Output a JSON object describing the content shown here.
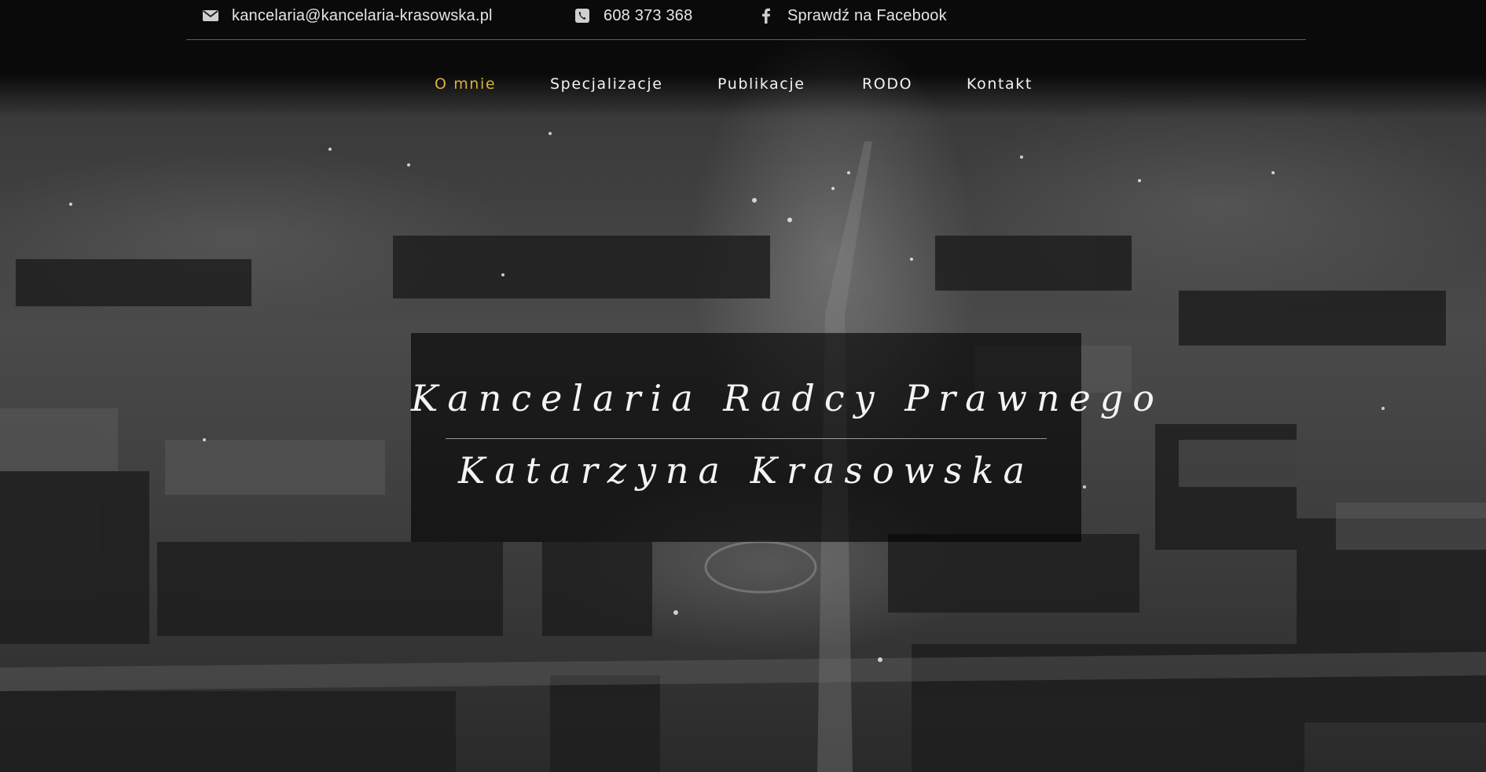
{
  "topbar": {
    "email": {
      "icon": "envelope-icon",
      "text": "kancelaria@kancelaria-krasowska.pl"
    },
    "phone": {
      "icon": "phone-square-icon",
      "text": "608 373 368"
    },
    "facebook": {
      "icon": "facebook-icon",
      "text": "Sprawdź na Facebook"
    }
  },
  "nav": {
    "items": [
      {
        "label": "O mnie",
        "active": true
      },
      {
        "label": "Specjalizacje",
        "active": false
      },
      {
        "label": "Publikacje",
        "active": false
      },
      {
        "label": "RODO",
        "active": false
      },
      {
        "label": "Kontakt",
        "active": false
      }
    ]
  },
  "hero": {
    "title_line1": "Kancelaria Radcy Prawnego",
    "title_line2": "Katarzyna Krasowska"
  },
  "colors": {
    "accent": "#d8b23a",
    "text": "#f2f2f2",
    "topbar_text": "#e6e6e6",
    "background": "#0b0b0b"
  }
}
